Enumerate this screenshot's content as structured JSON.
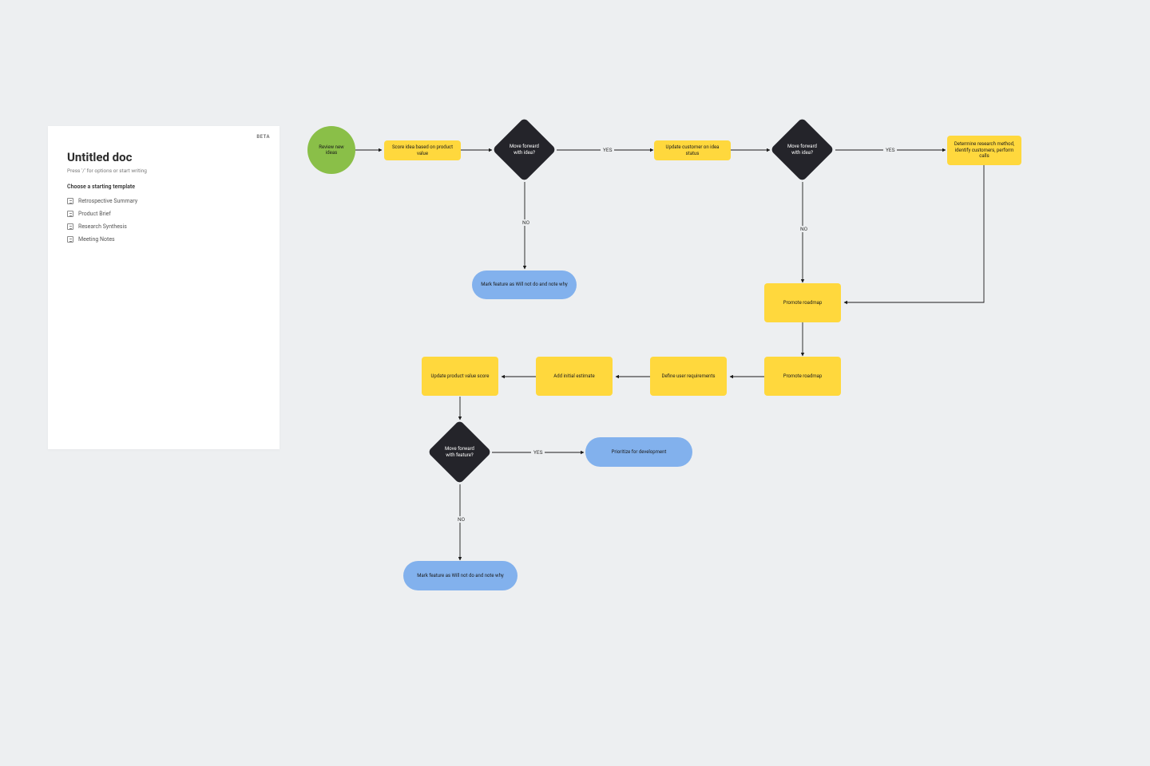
{
  "doc": {
    "badge": "BETA",
    "title": "Untitled doc",
    "hint": "Press '/' for options or start writing",
    "section_label": "Choose a starting template",
    "templates": [
      {
        "label": "Retrospective Summary"
      },
      {
        "label": "Product Brief"
      },
      {
        "label": "Research Synthesis"
      },
      {
        "label": "Meeting Notes"
      }
    ]
  },
  "flow": {
    "labels": {
      "yes": "YES",
      "no": "NO"
    },
    "nodes": {
      "start": "Review new ideas",
      "score": "Score idea based on product value",
      "d1": "Move forward with idea?",
      "update_status": "Update customer on idea status",
      "d2": "Move forward with idea?",
      "determine": "Determine research method, identify customers, perform calls",
      "mark1": "Mark feature as Will not do and note why",
      "promote1": "Promote roadmap",
      "promote2": "Promote roadmap",
      "define": "Define user requirements",
      "estimate": "Add initial estimate",
      "update_score": "Update product value score",
      "d3": "Move forward with feature?",
      "prioritize": "Prioritize for development",
      "mark2": "Mark feature as Will not do and note why"
    }
  },
  "colors": {
    "canvas": "#edeff1",
    "process": "#ffd83d",
    "decision": "#24242a",
    "terminator": "#82b1ed",
    "start": "#8abf48"
  }
}
